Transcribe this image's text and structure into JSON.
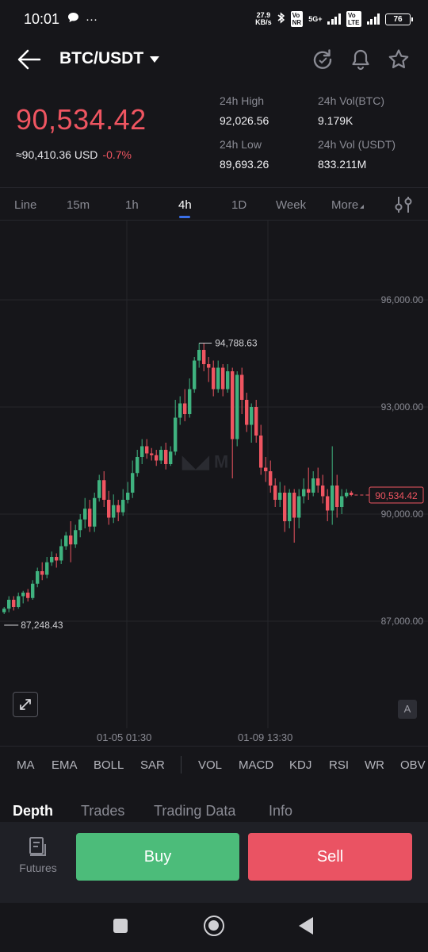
{
  "status_bar": {
    "time": "10:01",
    "net_speed_value": "27.9",
    "net_speed_unit": "KB/s",
    "network_label": "5G+",
    "battery": "76"
  },
  "header": {
    "pair": "BTC/USDT"
  },
  "ticker": {
    "last_price": "90,534.42",
    "usd_value": "≈90,410.36 USD",
    "change_pct": "-0.7%",
    "high_label": "24h High",
    "high_value": "92,026.56",
    "low_label": "24h Low",
    "low_value": "89,693.26",
    "vol_btc_label": "24h Vol(BTC)",
    "vol_btc_value": "9.179K",
    "vol_usdt_label": "24h Vol (USDT)",
    "vol_usdt_value": "833.211M"
  },
  "intervals": [
    {
      "label": "Line"
    },
    {
      "label": "15m"
    },
    {
      "label": "1h"
    },
    {
      "label": "4h",
      "active": true
    },
    {
      "label": "1D"
    },
    {
      "label": "Week"
    },
    {
      "label": "More"
    }
  ],
  "chart": {
    "y_ticks": [
      "96,000.00",
      "93,000.00",
      "90,000.00",
      "87,000.00"
    ],
    "high_marker": "94,788.63",
    "low_marker": "87,248.43",
    "current_price_tag": "90,534.42",
    "x_labels": [
      "01-05 01:30",
      "01-09 13:30"
    ],
    "auto_button": "A",
    "colors": {
      "up": "#3fb27f",
      "down": "#ef5561",
      "grid": "#25262b"
    }
  },
  "chart_data": {
    "type": "candlestick",
    "ylim": [
      85500,
      97500
    ],
    "candles": [
      [
        87250,
        87350,
        87400,
        87200
      ],
      [
        87350,
        87600,
        87700,
        87250
      ],
      [
        87600,
        87400,
        87700,
        87300
      ],
      [
        87400,
        87700,
        87800,
        87350
      ],
      [
        87700,
        87800,
        87850,
        87500
      ],
      [
        87800,
        87650,
        87900,
        87550
      ],
      [
        87650,
        88050,
        88150,
        87600
      ],
      [
        88050,
        88400,
        88500,
        87950
      ],
      [
        88400,
        88300,
        88650,
        88150
      ],
      [
        88300,
        88650,
        88800,
        88200
      ],
      [
        88650,
        88800,
        88950,
        88550
      ],
      [
        88800,
        88700,
        88900,
        88500
      ],
      [
        88700,
        89100,
        89300,
        88600
      ],
      [
        89100,
        89400,
        89500,
        89000
      ],
      [
        89400,
        89150,
        89800,
        88650
      ],
      [
        89150,
        89550,
        89700,
        89050
      ],
      [
        89550,
        89850,
        90000,
        89350
      ],
      [
        89850,
        90150,
        90450,
        89600
      ],
      [
        90150,
        89650,
        90400,
        89500
      ],
      [
        89650,
        90450,
        90600,
        89500
      ],
      [
        90450,
        90950,
        91100,
        90350
      ],
      [
        90950,
        90400,
        91200,
        90200
      ],
      [
        90400,
        89900,
        90650,
        89700
      ],
      [
        89900,
        90250,
        90550,
        89750
      ],
      [
        90250,
        90050,
        90400,
        89800
      ],
      [
        90050,
        90400,
        90700,
        89950
      ],
      [
        90400,
        90600,
        90900,
        90300
      ],
      [
        90600,
        91150,
        91500,
        90450
      ],
      [
        91150,
        91600,
        91800,
        91050
      ],
      [
        91600,
        91900,
        92100,
        91400
      ],
      [
        91900,
        91700,
        92100,
        91550
      ],
      [
        91700,
        91650,
        91850,
        91500
      ],
      [
        91650,
        91500,
        91800,
        91350
      ],
      [
        91500,
        91800,
        91900,
        91400
      ],
      [
        91800,
        91400,
        92000,
        91250
      ],
      [
        91400,
        91750,
        91900,
        91350
      ],
      [
        91750,
        92700,
        93200,
        91650
      ],
      [
        92700,
        93100,
        93300,
        92500
      ],
      [
        93100,
        92800,
        93500,
        92600
      ],
      [
        92800,
        93500,
        93800,
        92700
      ],
      [
        93500,
        94300,
        94400,
        93400
      ],
      [
        94300,
        94600,
        94789,
        94100
      ],
      [
        94600,
        94200,
        94789,
        94000
      ],
      [
        94200,
        94100,
        94400,
        93700
      ],
      [
        94100,
        93500,
        94300,
        93300
      ],
      [
        93500,
        94100,
        94300,
        93400
      ],
      [
        94100,
        93500,
        94200,
        93300
      ],
      [
        93500,
        94000,
        94200,
        93400
      ],
      [
        94000,
        92100,
        94100,
        91000
      ],
      [
        92100,
        93900,
        94000,
        91900
      ],
      [
        93900,
        93200,
        94100,
        92800
      ],
      [
        93200,
        92500,
        93400,
        92300
      ],
      [
        92500,
        93000,
        93100,
        92000
      ],
      [
        93000,
        92200,
        93200,
        92000
      ],
      [
        92200,
        91300,
        92500,
        91100
      ],
      [
        91300,
        91200,
        91600,
        90900
      ],
      [
        91200,
        90800,
        91500,
        90600
      ],
      [
        90800,
        90400,
        91000,
        90200
      ],
      [
        90400,
        90600,
        90900,
        90200
      ],
      [
        90600,
        89800,
        90800,
        89500
      ],
      [
        89800,
        90600,
        90700,
        89600
      ],
      [
        90600,
        89900,
        90700,
        89200
      ],
      [
        89900,
        90500,
        90700,
        89600
      ],
      [
        90500,
        90700,
        91000,
        90300
      ],
      [
        90700,
        90600,
        91300,
        90400
      ],
      [
        90600,
        91000,
        91200,
        90500
      ],
      [
        91000,
        90800,
        91300,
        90600
      ],
      [
        90800,
        90500,
        91100,
        90300
      ],
      [
        90500,
        90100,
        90700,
        89800
      ],
      [
        90100,
        90800,
        91900,
        89700
      ],
      [
        90800,
        90200,
        91100,
        89900
      ],
      [
        90200,
        90500,
        90700,
        90000
      ],
      [
        90500,
        90600,
        90700,
        90450
      ],
      [
        90600,
        90534,
        90650,
        90500
      ]
    ]
  },
  "indicators": [
    "MA",
    "EMA",
    "BOLL",
    "SAR",
    "VOL",
    "MACD",
    "KDJ",
    "RSI",
    "WR",
    "OBV"
  ],
  "bottom_tabs": [
    {
      "label": "Depth",
      "active": true
    },
    {
      "label": "Trades"
    },
    {
      "label": "Trading Data"
    },
    {
      "label": "Info"
    }
  ],
  "actions": {
    "futures_label": "Futures",
    "buy_label": "Buy",
    "sell_label": "Sell"
  }
}
